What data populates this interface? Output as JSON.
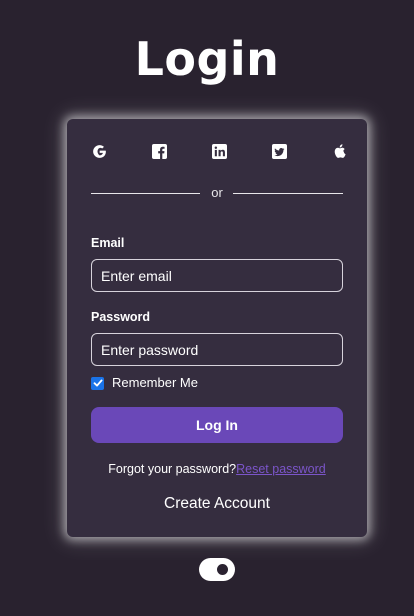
{
  "page": {
    "title": "Login"
  },
  "socials": [
    {
      "name": "google",
      "icon": "google-icon"
    },
    {
      "name": "facebook",
      "icon": "facebook-icon"
    },
    {
      "name": "linkedin",
      "icon": "linkedin-icon"
    },
    {
      "name": "twitter",
      "icon": "twitter-icon"
    },
    {
      "name": "apple",
      "icon": "apple-icon"
    }
  ],
  "divider": {
    "text": "or"
  },
  "email": {
    "label": "Email",
    "placeholder": "Enter email",
    "value": ""
  },
  "password": {
    "label": "Password",
    "placeholder": "Enter password",
    "value": ""
  },
  "remember": {
    "label": "Remember Me",
    "checked": true
  },
  "login_button": {
    "label": "Log In"
  },
  "forgot": {
    "text": "Forgot your password?",
    "link": "Reset password"
  },
  "create_account": {
    "label": "Create Account"
  },
  "theme_toggle": {
    "state": "dark"
  },
  "colors": {
    "background": "#29222f",
    "card": "#352d3f",
    "accent": "#6a48b8",
    "link": "#7b55c9",
    "checkbox": "#1a73e8"
  }
}
